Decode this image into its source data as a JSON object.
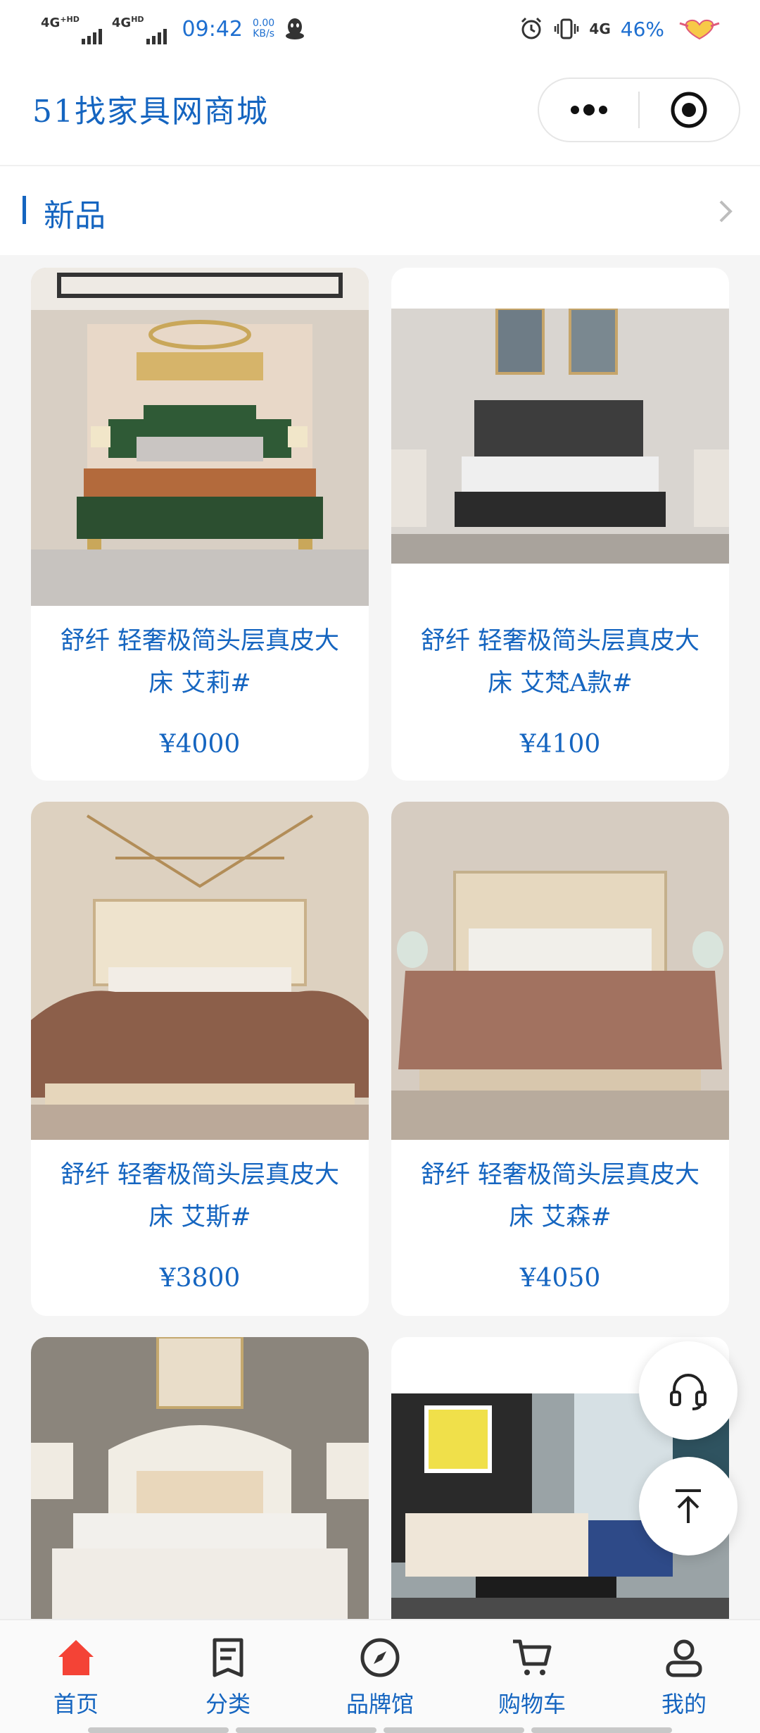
{
  "status_bar": {
    "network_1": "4G",
    "network_1_sup": "+HD",
    "network_2": "4G",
    "network_2_sup": "HD",
    "time": "09:42",
    "speed_value": "0.00",
    "speed_unit": "KB/s",
    "network_3": "4G",
    "battery": "46%",
    "icons": [
      "qq-icon",
      "alarm-icon",
      "vibrate-icon",
      "battery-heart-icon"
    ]
  },
  "navbar": {
    "title": "51找家具网商城",
    "capsule_icons": [
      "more-dots-icon",
      "record-close-icon"
    ]
  },
  "section": {
    "title": "新品"
  },
  "products": [
    {
      "name": "舒纤 轻奢极简头层真皮大床 艾莉#",
      "price": "¥4000",
      "image": "green-velvet-bed"
    },
    {
      "name": "舒纤 轻奢极简头层真皮大床 艾梵A款#",
      "price": "¥4100",
      "image": "black-diamond-bed"
    },
    {
      "name": "舒纤 轻奢极简头层真皮大床 艾斯#",
      "price": "¥3800",
      "image": "cream-bed-brown-cover"
    },
    {
      "name": "舒纤 轻奢极简头层真皮大床 艾森#",
      "price": "¥4050",
      "image": "cream-panel-bed"
    },
    {
      "name": "",
      "price": "",
      "image": "white-tufted-bed"
    },
    {
      "name": "",
      "price": "",
      "image": "living-room-sofa"
    }
  ],
  "fabs": {
    "service_icon": "headset-icon",
    "top_icon": "arrow-up-icon"
  },
  "tabbar": {
    "items": [
      {
        "label": "首页",
        "icon": "home-icon",
        "active": true
      },
      {
        "label": "分类",
        "icon": "category-icon",
        "active": false
      },
      {
        "label": "品牌馆",
        "icon": "compass-icon",
        "active": false
      },
      {
        "label": "购物车",
        "icon": "cart-icon",
        "active": false
      },
      {
        "label": "我的",
        "icon": "user-icon",
        "active": false
      }
    ]
  },
  "colors": {
    "accent": "#1565c0",
    "home_active": "#f44336",
    "icon_dark": "#333333"
  }
}
